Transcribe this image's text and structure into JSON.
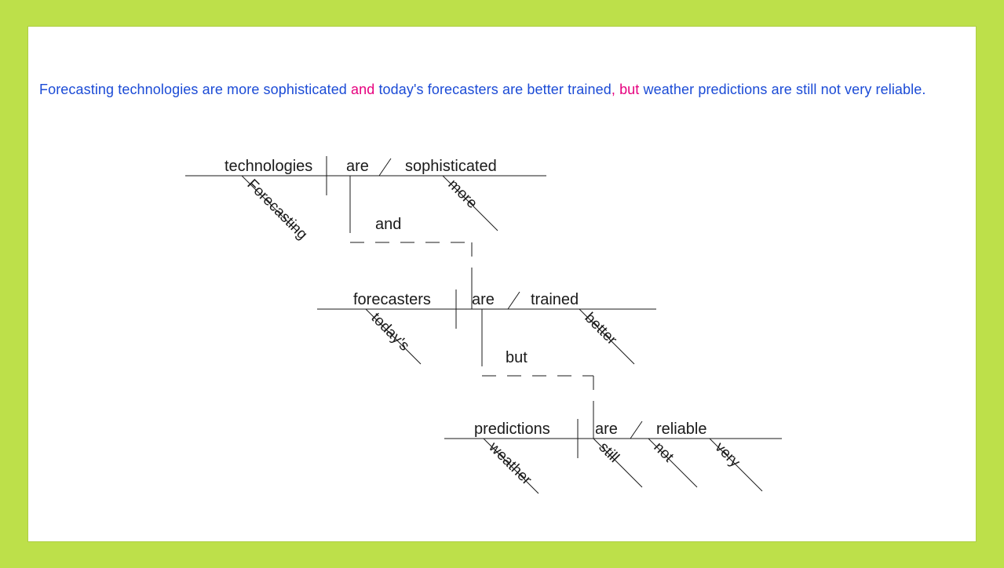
{
  "colors": {
    "frame": "#bde04a",
    "page": "#ffffff",
    "sentence": "#1b4bd6",
    "conjunction": "#e6007e",
    "diagram": "#1a1a1a"
  },
  "sentence": {
    "part1": "Forecasting technologies are more sophisticated ",
    "conj1": "and",
    "part2": " today's forecasters are better trained",
    "comma": ", ",
    "conj2": "but",
    "part3": " weather predictions are still not very reliable."
  },
  "diagram": {
    "clause1": {
      "subject": "technologies",
      "subject_mod": "Forecasting",
      "verb": "are",
      "complement": "sophisticated",
      "complement_mod": "more"
    },
    "conj1": "and",
    "clause2": {
      "subject": "forecasters",
      "subject_mod": "today's",
      "verb": "are",
      "complement": "trained",
      "complement_mod": "better"
    },
    "conj2": "but",
    "clause3": {
      "subject": "predictions",
      "subject_mod": "weather",
      "verb": "are",
      "verb_mod": "still",
      "complement": "reliable",
      "complement_mod1": "not",
      "complement_mod2": "very"
    }
  }
}
